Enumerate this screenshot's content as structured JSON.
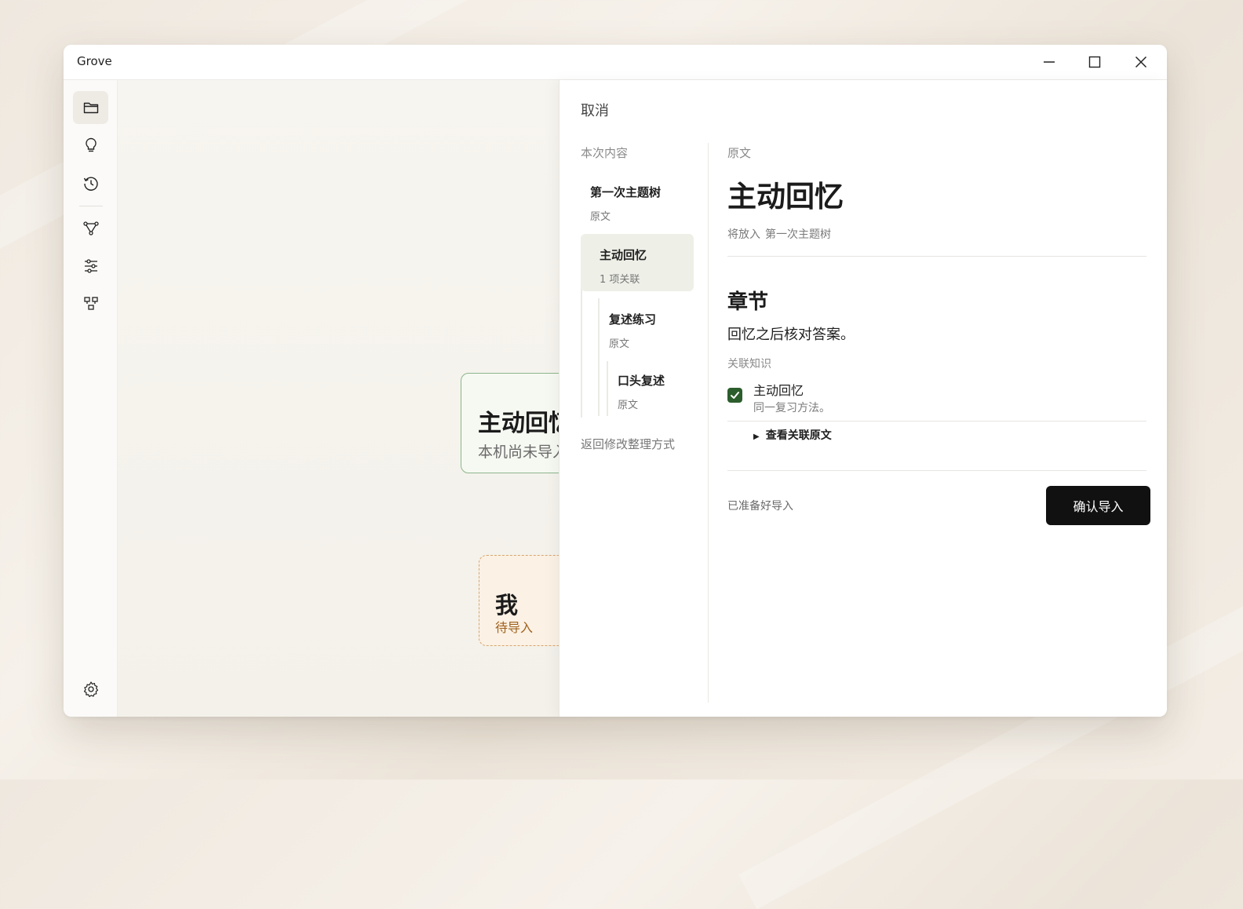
{
  "window": {
    "title": "Grove"
  },
  "sidebar": {
    "items": [
      {
        "icon": "folder-icon",
        "active": true
      },
      {
        "icon": "lightbulb-icon",
        "active": false
      },
      {
        "icon": "history-icon",
        "active": false
      },
      {
        "icon": "graph-icon",
        "active": false
      },
      {
        "icon": "sliders-icon",
        "active": false
      },
      {
        "icon": "layout-icon",
        "active": false
      }
    ],
    "bottom": {
      "icon": "gear-icon"
    }
  },
  "canvas": {
    "main_node": {
      "title": "主动回忆",
      "subtitle": "本机尚未导入"
    },
    "me_node": {
      "title": "我",
      "subtitle": "待导入"
    }
  },
  "panel": {
    "cancel_label": "取消",
    "nav": {
      "heading": "本次内容",
      "items": [
        {
          "name": "第一次主题树",
          "meta": "原文"
        },
        {
          "name": "主动回忆",
          "meta": "1 项关联"
        },
        {
          "name": "复述练习",
          "meta": "原文"
        },
        {
          "name": "口头复述",
          "meta": "原文"
        }
      ],
      "back_label": "返回修改整理方式"
    },
    "content": {
      "label": "原文",
      "title": "主动回忆",
      "dest_prefix": "将放入",
      "dest_name": "第一次主题树",
      "section_title": "章节",
      "body": "回忆之后核对答案。",
      "related_heading": "关联知识",
      "related": {
        "name": "主动回忆",
        "desc": "同一复习方法。",
        "checked": true
      },
      "disclosure_label": "查看关联原文",
      "status": "已准备好导入",
      "confirm_label": "确认导入"
    }
  },
  "colors": {
    "accent": "#2c5d2c",
    "button": "#111111",
    "selected_bg": "#eef0e8"
  }
}
